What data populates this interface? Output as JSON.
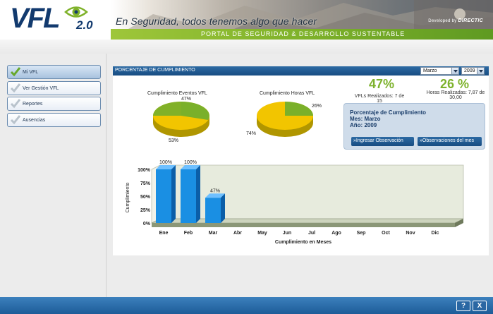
{
  "header": {
    "logo_text": "VFL",
    "logo_version": "2.0",
    "tagline": "En Seguridad, todos tenemos algo que hacer",
    "portal_title": "PORTAL DE SEGURIDAD & DESARROLLO SUSTENTABLE",
    "developed_by": "Developed by",
    "developer": "DIRECTIC"
  },
  "sidebar": {
    "items": [
      {
        "label": "Mi VFL",
        "active": true
      },
      {
        "label": "Ver Gestión VFL",
        "active": false
      },
      {
        "label": "Reportes",
        "active": false
      },
      {
        "label": "Ausencias",
        "active": false
      }
    ]
  },
  "panel": {
    "title": "PORCENTAJE DE CUMPLIMIENTO",
    "month_select": "Marzo",
    "year_select": "2009"
  },
  "pies": [
    {
      "title": "Cumplimiento Eventos VFL",
      "completed_pct": "47%",
      "remaining_pct": "53%"
    },
    {
      "title": "Cumplimiento Horas VFL",
      "completed_pct": "26%",
      "remaining_pct": "74%"
    }
  ],
  "stats": {
    "vfl_pct": "47%",
    "vfl_label": "VFLs Realizados: 7 de 15",
    "hours_pct": "26 %",
    "hours_label_1": "Horas Realizadas: 7,87 de",
    "hours_label_2": "30,00"
  },
  "info": {
    "line1": "Porcentaje de Cumplimiento",
    "line2": "Mes: Marzo",
    "line3": "Año: 2009",
    "btn_ingresar": "Ingresar Observación",
    "btn_observaciones": "Observaciones del mes"
  },
  "colors": {
    "completed": "#7ab02a",
    "remaining": "#f2c500",
    "bar": "#1a8fe3",
    "accent": "#7db22c",
    "header_blue": "#174c82"
  },
  "chart_data": {
    "type": "bar",
    "categories": [
      "Ene",
      "Feb",
      "Mar",
      "Abr",
      "May",
      "Jun",
      "Jul",
      "Ago",
      "Sep",
      "Oct",
      "Nov",
      "Dic"
    ],
    "values": [
      100,
      100,
      47,
      null,
      null,
      null,
      null,
      null,
      null,
      null,
      null,
      null
    ],
    "data_labels": [
      "100%",
      "100%",
      "47%",
      "",
      "",
      "",
      "",
      "",
      "",
      "",
      "",
      ""
    ],
    "xlabel": "Cumplimiento en Meses",
    "ylabel": "Cumplimiento",
    "yticks": [
      "100%",
      "75%",
      "50%",
      "25%",
      "0%"
    ],
    "ylim": [
      0,
      100
    ],
    "grid": false
  },
  "footer": {
    "help": "?",
    "close": "X"
  }
}
